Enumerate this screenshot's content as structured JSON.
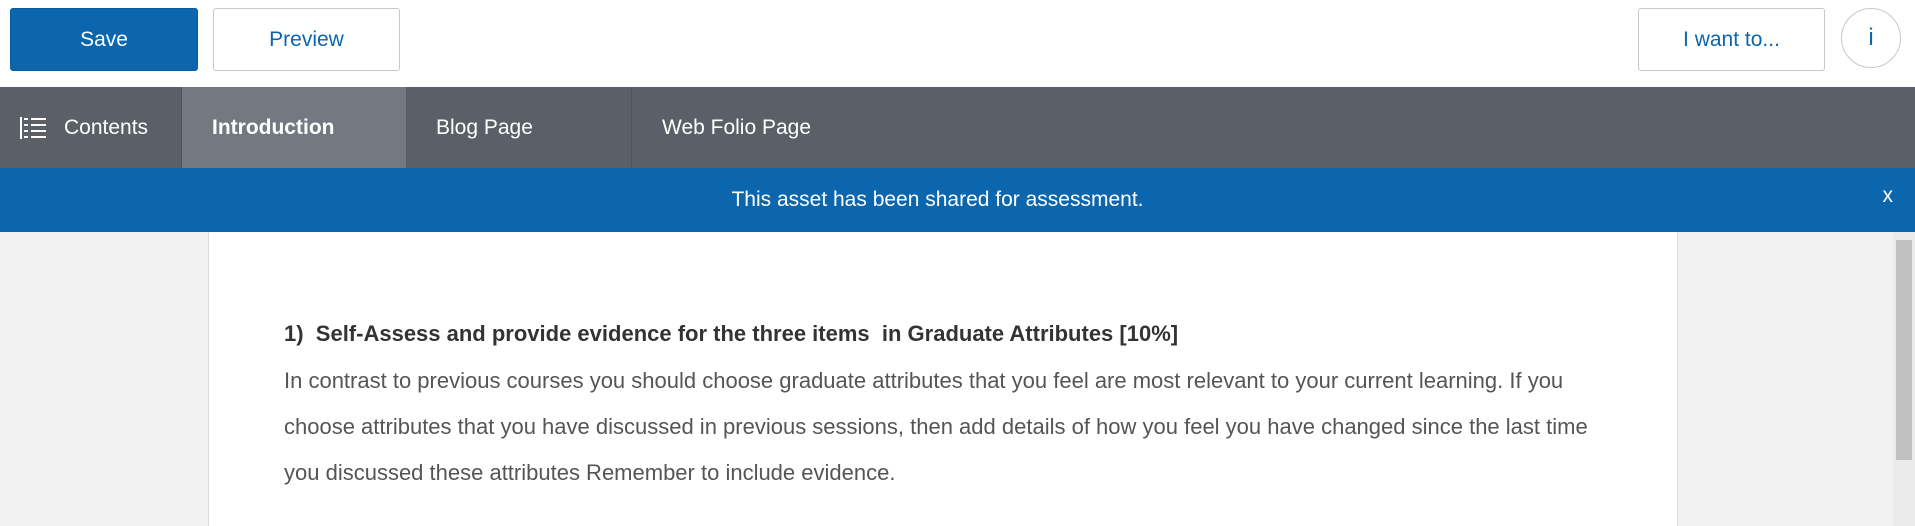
{
  "toolbar": {
    "save_label": "Save",
    "preview_label": "Preview",
    "i_want_label": "I want to...",
    "info_label": "i"
  },
  "tabs": {
    "contents_label": "Contents",
    "items": [
      {
        "label": "Introduction",
        "active": true
      },
      {
        "label": "Blog Page",
        "active": false
      },
      {
        "label": "Web Folio Page",
        "active": false
      }
    ]
  },
  "banner": {
    "message": "This asset has been shared for assessment.",
    "close_label": "x"
  },
  "content": {
    "heading": "1)  Self-Assess and provide evidence for the three items  in Graduate Attributes [10%]",
    "paragraph": "In contrast to previous courses you should choose graduate attributes that you feel are most relevant to your current learning. If you choose attributes that you have discussed in previous sessions, then add details of how you feel you have changed since the last time you discussed these attributes Remember to include evidence."
  },
  "colors": {
    "accent": "#0b66ae",
    "tabbar": "#5b6068",
    "active_tab": "#737881"
  }
}
